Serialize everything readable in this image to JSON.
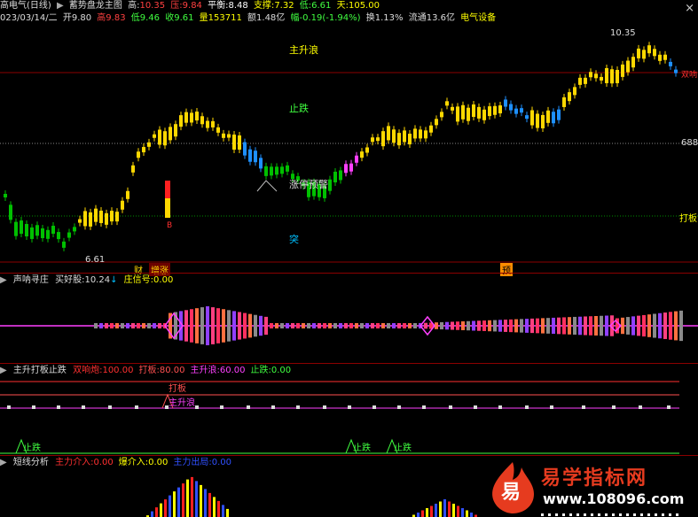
{
  "header": {
    "line1": {
      "stock_name": "高电气(日线)",
      "indicator": "蓄势盘龙主图",
      "high_label": "高:",
      "high_value": "10.35",
      "pressure_label": "压:",
      "pressure_value": "9.84",
      "balance_label": "平衡:",
      "balance_value": "8.48",
      "support_label": "支撑:",
      "support_value": "7.32",
      "low_label": "低:",
      "low_value": "6.61",
      "sky_label": "天:",
      "sky_value": "105.00"
    },
    "line2": {
      "date": "023/03/14/二",
      "open": "开9.80",
      "high": "高9.83",
      "low": "低9.46",
      "close": "收9.61",
      "volume": "量153711",
      "amount": "额1.48亿",
      "change": "幅-0.19(-1.94%)",
      "turnover": "换1.13%",
      "float": "流通13.6亿",
      "sector": "电气设备"
    }
  },
  "main_chart": {
    "labels": {
      "zhushenglang": "主升浪",
      "zhidie": "止跌",
      "zhangting": "涨停预警",
      "tu": "突",
      "max_price": "10.35",
      "min_price": "6.61",
      "line_688": "688",
      "daban": "打板",
      "shuangxiang": "双响",
      "cai": "财",
      "zengzhang": "增涨",
      "yu": "预",
      "b_mark": "B"
    }
  },
  "panel2": {
    "name": "声呐寻庄",
    "buy_label": "买好股:",
    "buy_value": "10.24",
    "signal_label": "庄信号:",
    "signal_value": "0.00"
  },
  "panel3": {
    "name": "主升打板止跌",
    "items": [
      {
        "label": "双响炮:",
        "value": "100.00",
        "color": "#ff3030"
      },
      {
        "label": "打板:",
        "value": "80.00",
        "color": "#ff5050"
      },
      {
        "label": "主升浪:",
        "value": "60.00",
        "color": "#ff40ff"
      },
      {
        "label": "止跌:",
        "value": "0.00",
        "color": "#40ff40"
      }
    ],
    "marks": {
      "daban": "打板",
      "zhushenglang": "主升浪",
      "zhidie": "止跌"
    }
  },
  "panel4": {
    "name": "短线分析",
    "items": [
      {
        "label": "主力介入:",
        "value": "0.00",
        "color": "#ff3030"
      },
      {
        "label": "爆介入:",
        "value": "0.00",
        "color": "#ffff00"
      },
      {
        "label": "主力出局:",
        "value": "0.00",
        "color": "#3050ff"
      }
    ]
  },
  "watermark": {
    "logo_char": "易",
    "title": "易学指标网",
    "url": "www.108096.com"
  },
  "colors": {
    "up_yellow": "#ffd800",
    "green": "#00c000",
    "blue": "#1e90ff",
    "magenta": "#ff40ff",
    "red": "#ff2020",
    "grid_red": "#8b0000"
  }
}
